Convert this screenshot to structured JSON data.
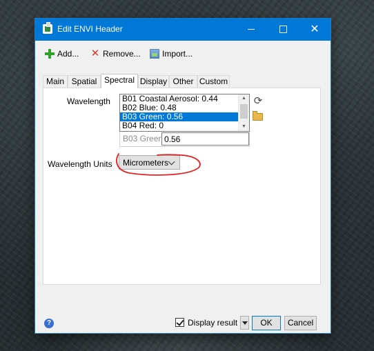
{
  "window": {
    "title": "Edit ENVI Header",
    "controls": {
      "minimize": "minimize",
      "maximize": "maximize",
      "close": "✕"
    }
  },
  "toolbar": {
    "add_label": "Add...",
    "remove_label": "Remove...",
    "import_label": "Import..."
  },
  "tabs": [
    "Main",
    "Spatial",
    "Spectral",
    "Display",
    "Other",
    "Custom"
  ],
  "active_tab": "Spectral",
  "spectral": {
    "wavelength_label": "Wavelength",
    "wavelength_items": [
      "B01 Coastal Aerosol: 0.44",
      "B02 Blue: 0.48",
      "B03 Green: 0.56",
      "B04 Red: 0"
    ],
    "selected_item": "B03 Green: 0.56",
    "edit_label": "B03 Green:",
    "edit_value": "0.56",
    "units_label": "Wavelength Units",
    "units_value": "Micrometers"
  },
  "footer": {
    "help": "?",
    "display_result_label": "Display result",
    "display_result_checked": true,
    "ok_label": "OK",
    "cancel_label": "Cancel"
  },
  "colors": {
    "titlebar": "#0078d7",
    "selection": "#0078d7",
    "annotation": "#e02020"
  }
}
